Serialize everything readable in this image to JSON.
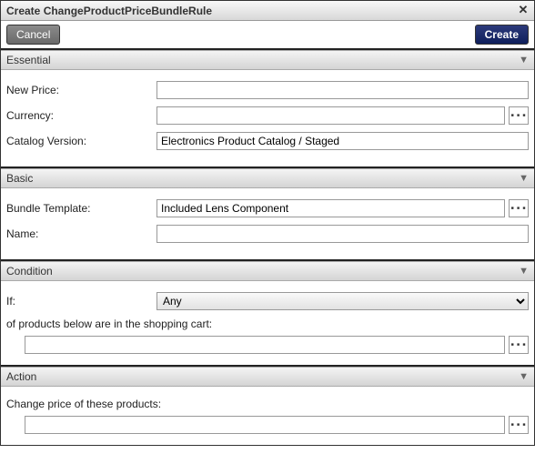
{
  "dialog": {
    "title": "Create ChangeProductPriceBundleRule",
    "close_glyph": "✕"
  },
  "buttons": {
    "cancel": "Cancel",
    "create": "Create"
  },
  "sections": {
    "essential": {
      "header": "Essential",
      "new_price_label": "New Price:",
      "new_price_value": "",
      "currency_label": "Currency:",
      "currency_value": "",
      "catalog_version_label": "Catalog Version:",
      "catalog_version_value": "Electronics Product Catalog / Staged"
    },
    "basic": {
      "header": "Basic",
      "bundle_template_label": "Bundle Template:",
      "bundle_template_value": "Included Lens Component",
      "name_label": "Name:",
      "name_value": ""
    },
    "condition": {
      "header": "Condition",
      "if_label": "If:",
      "if_selected": "Any",
      "static_line": "of products below are in the shopping cart:",
      "products_value": ""
    },
    "action": {
      "header": "Action",
      "static_line": "Change price of these products:",
      "products_value": ""
    }
  },
  "glyphs": {
    "ellipsis": "▪▪▪",
    "chevron_down": "▼"
  }
}
